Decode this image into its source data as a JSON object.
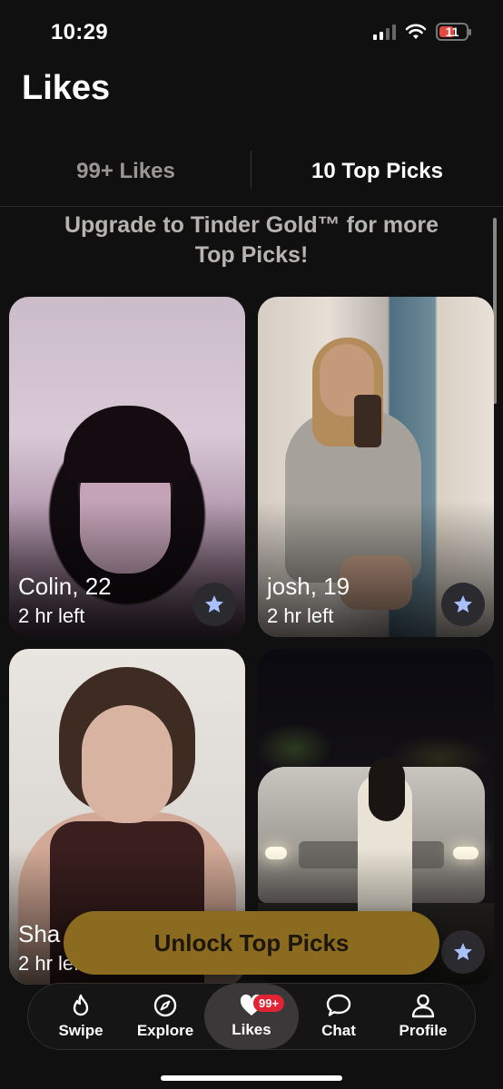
{
  "status_bar": {
    "time": "10:29",
    "battery": "11"
  },
  "page_title": "Likes",
  "tabs": [
    {
      "label": "99+ Likes",
      "active": false
    },
    {
      "label": "10 Top Picks",
      "active": true
    }
  ],
  "upgrade_text": "Upgrade to Tinder Gold™ for more Top Picks!",
  "cards": [
    {
      "name": "Colin, 22",
      "time_left": "2 hr left"
    },
    {
      "name": "josh, 19",
      "time_left": "2 hr left"
    },
    {
      "name": "Sha",
      "time_left": "2 hr left"
    },
    {
      "name": "",
      "time_left": ""
    }
  ],
  "unlock_button": "Unlock Top Picks",
  "nav": {
    "items": [
      {
        "label": "Swipe",
        "icon": "flame-icon"
      },
      {
        "label": "Explore",
        "icon": "compass-icon"
      },
      {
        "label": "Likes",
        "icon": "heart-icon",
        "badge": "99+"
      },
      {
        "label": "Chat",
        "icon": "chat-bubble-icon"
      },
      {
        "label": "Profile",
        "icon": "person-icon"
      }
    ]
  },
  "colors": {
    "background": "#111010",
    "unlock_button": "#8a6b1f",
    "badge": "#e02433",
    "star": "#a9c0ff"
  }
}
